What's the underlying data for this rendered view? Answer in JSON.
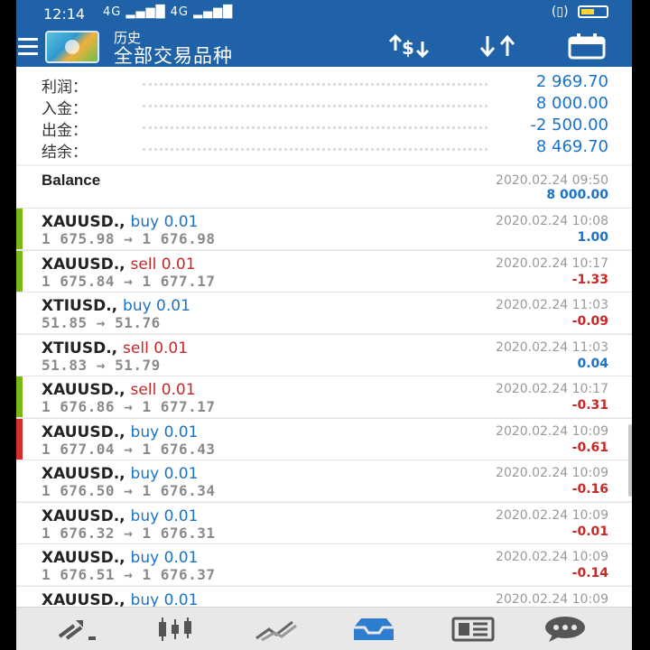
{
  "status_bar": {
    "time": "12:14",
    "signal": "4G ▂▄▆█ 4G ▂▄▆█",
    "right_text": "(▯)"
  },
  "toolbar": {
    "title": "历史",
    "subtitle": "全部交易品种"
  },
  "summary": [
    {
      "label": "利润：",
      "value": "2 969.70"
    },
    {
      "label": "入金：",
      "value": "8 000.00"
    },
    {
      "label": "出金：",
      "value": "-2 500.00"
    },
    {
      "label": "结余：",
      "value": "8 469.70"
    }
  ],
  "balance": {
    "label": "Balance",
    "date": "2020.02.24 09:50",
    "value": "8 000.00"
  },
  "trades": [
    {
      "symbol": "XAUUSD.,",
      "side": "buy",
      "volume": "buy 0.01",
      "prices": "1 675.98 → 1 676.98",
      "date": "2020.02.24 10:08",
      "profit": "1.00",
      "bar": "#7cb518"
    },
    {
      "symbol": "XAUUSD.,",
      "side": "sell",
      "volume": "sell 0.01",
      "prices": "1 675.84 → 1 677.17",
      "date": "2020.02.24 10:17",
      "profit": "-1.33",
      "bar": "#7cb518"
    },
    {
      "symbol": "XTIUSD.,",
      "side": "buy",
      "volume": "buy 0.01",
      "prices": "51.85 → 51.76",
      "date": "2020.02.24 11:03",
      "profit": "-0.09",
      "bar": ""
    },
    {
      "symbol": "XTIUSD.,",
      "side": "sell",
      "volume": "sell 0.01",
      "prices": "51.83 → 51.79",
      "date": "2020.02.24 11:03",
      "profit": "0.04",
      "bar": ""
    },
    {
      "symbol": "XAUUSD.,",
      "side": "sell",
      "volume": "sell 0.01",
      "prices": "1 676.86 → 1 677.17",
      "date": "2020.02.24 10:17",
      "profit": "-0.31",
      "bar": "#7cb518"
    },
    {
      "symbol": "XAUUSD.,",
      "side": "buy",
      "volume": "buy 0.01",
      "prices": "1 677.04 → 1 676.43",
      "date": "2020.02.24 10:09",
      "profit": "-0.61",
      "bar": "#d32f2f"
    },
    {
      "symbol": "XAUUSD.,",
      "side": "buy",
      "volume": "buy 0.01",
      "prices": "1 676.50 → 1 676.34",
      "date": "2020.02.24 10:09",
      "profit": "-0.16",
      "bar": ""
    },
    {
      "symbol": "XAUUSD.,",
      "side": "buy",
      "volume": "buy 0.01",
      "prices": "1 676.32 → 1 676.31",
      "date": "2020.02.24 10:09",
      "profit": "-0.01",
      "bar": ""
    },
    {
      "symbol": "XAUUSD.,",
      "side": "buy",
      "volume": "buy 0.01",
      "prices": "1 676.51 → 1 676.37",
      "date": "2020.02.24 10:09",
      "profit": "-0.14",
      "bar": ""
    },
    {
      "symbol": "XAUUSD.,",
      "side": "buy",
      "volume": "buy 0.01",
      "prices": "",
      "date": "2020.02.24 10:09",
      "profit": "",
      "bar": ""
    }
  ],
  "bottom_nav": [
    {
      "icon": "quotes-icon",
      "active": false
    },
    {
      "icon": "chart-candles-icon",
      "active": false
    },
    {
      "icon": "trade-icon",
      "active": false
    },
    {
      "icon": "history-inbox-icon",
      "active": true
    },
    {
      "icon": "news-icon",
      "active": false
    },
    {
      "icon": "chat-icon",
      "active": false
    }
  ],
  "colors": {
    "primary": "#1f62a8",
    "profit_positive": "#1a73c8",
    "profit_negative": "#c62828",
    "bar_green": "#7cb518",
    "bar_red": "#d32f2f",
    "active_nav": "#2e7dd1"
  }
}
